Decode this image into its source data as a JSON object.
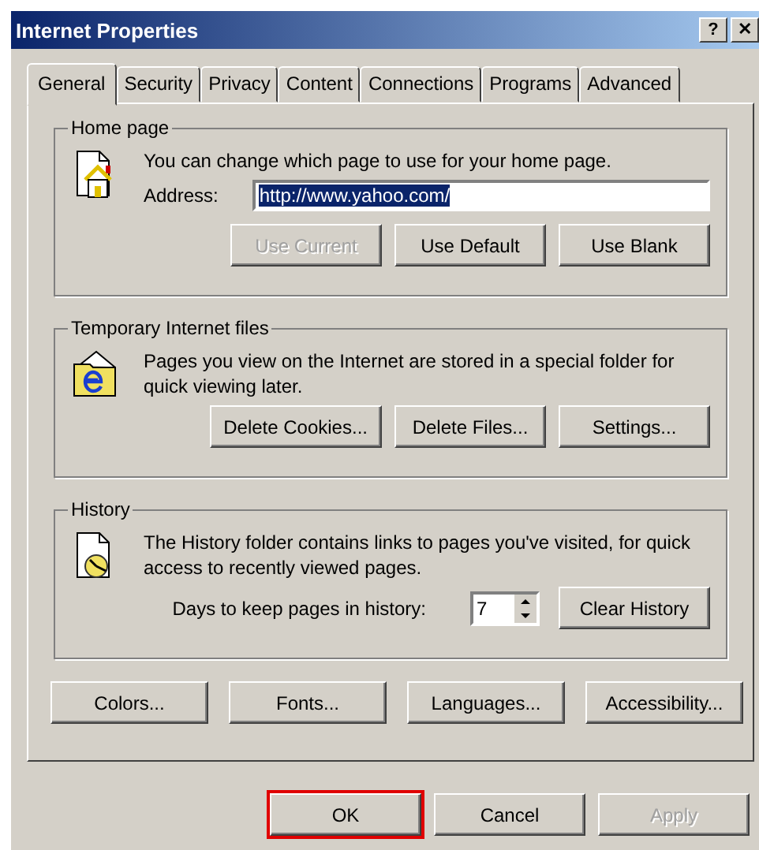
{
  "window": {
    "title": "Internet Properties",
    "title_buttons": [
      "?",
      "✕"
    ]
  },
  "tabs": [
    {
      "label": "General",
      "selected": true
    },
    {
      "label": "Security",
      "selected": false
    },
    {
      "label": "Privacy",
      "selected": false
    },
    {
      "label": "Content",
      "selected": false
    },
    {
      "label": "Connections",
      "selected": false
    },
    {
      "label": "Programs",
      "selected": false
    },
    {
      "label": "Advanced",
      "selected": false
    }
  ],
  "home_page": {
    "title": "Home page",
    "description": "You can change which page to use for your home page.",
    "address_label": "Address:",
    "address_value": "http://www.yahoo.com/",
    "address_selected": true,
    "buttons": [
      {
        "label": "Use Current",
        "disabled": true
      },
      {
        "label": "Use Default",
        "disabled": false
      },
      {
        "label": "Use Blank",
        "disabled": false
      }
    ]
  },
  "temp_files": {
    "title": "Temporary Internet files",
    "description": "Pages you view on the Internet are stored in a special folder for quick viewing later.",
    "buttons": [
      {
        "label": "Delete Cookies...",
        "disabled": false
      },
      {
        "label": "Delete Files...",
        "disabled": false
      },
      {
        "label": "Settings...",
        "disabled": false
      }
    ]
  },
  "history": {
    "title": "History",
    "description": "The History folder contains links to pages you've visited, for quick access to recently viewed pages.",
    "days_label": "Days to keep pages in history:",
    "days_value": "7",
    "buttons": [
      {
        "label": "Clear History",
        "disabled": false
      }
    ]
  },
  "bottom_buttons": [
    {
      "label": "Colors...",
      "disabled": false
    },
    {
      "label": "Fonts...",
      "disabled": false
    },
    {
      "label": "Languages...",
      "disabled": false
    },
    {
      "label": "Accessibility...",
      "disabled": false
    }
  ],
  "dialog_buttons": [
    {
      "label": "OK",
      "disabled": false,
      "highlighted": true
    },
    {
      "label": "Cancel",
      "disabled": false,
      "highlighted": false
    },
    {
      "label": "Apply",
      "disabled": true,
      "highlighted": false
    }
  ]
}
